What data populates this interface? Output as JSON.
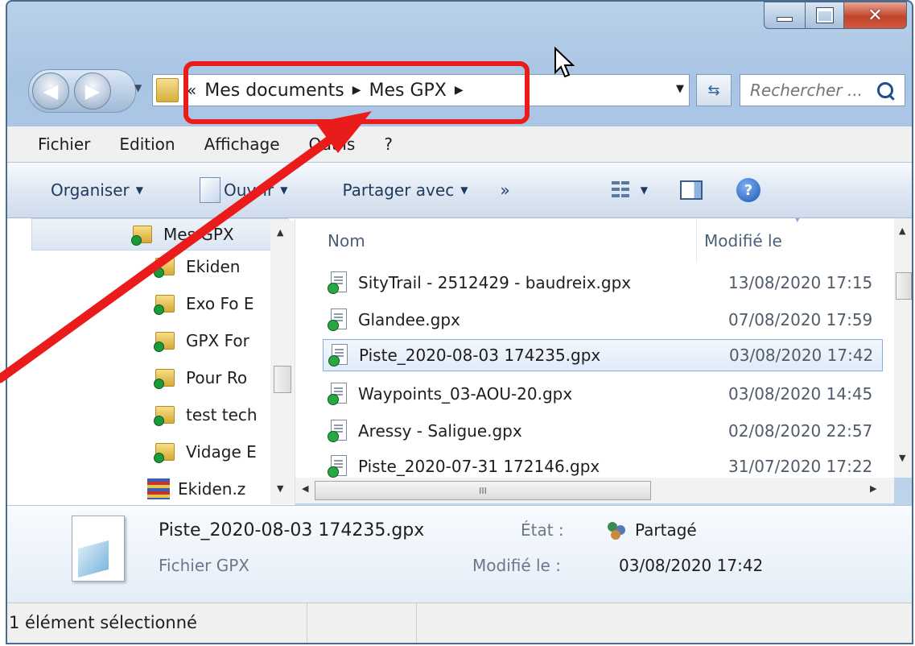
{
  "window": {
    "caption_minimize_icon": "minimize-icon",
    "caption_maximize_icon": "maximize-icon",
    "caption_close_icon": "close-icon"
  },
  "address_bar": {
    "overflow": "«",
    "breadcrumbs": [
      "Mes documents",
      "Mes GPX"
    ],
    "separator": "▶"
  },
  "search": {
    "placeholder": "Rechercher ..."
  },
  "menu": [
    "Fichier",
    "Edition",
    "Affichage",
    "Outils",
    "?"
  ],
  "toolbar": {
    "organize": "Organiser",
    "open": "Ouvrir",
    "share": "Partager avec",
    "more": "»"
  },
  "nav_tree": {
    "selected": "Mes GPX",
    "items": [
      "Ekiden",
      "Exo Fo E",
      "GPX For",
      "Pour Ro",
      "test tech",
      "Vidage E"
    ],
    "zip_item": "Ekiden.z"
  },
  "file_list": {
    "columns": [
      "Nom",
      "Modifié le"
    ],
    "rows": [
      {
        "name": "SityTrail - 2512429 - baudreix.gpx",
        "modified": "13/08/2020 17:15"
      },
      {
        "name": "Glandee.gpx",
        "modified": "07/08/2020 17:59"
      },
      {
        "name": "Piste_2020-08-03 174235.gpx",
        "modified": "03/08/2020 17:42",
        "selected": true
      },
      {
        "name": "Waypoints_03-AOU-20.gpx",
        "modified": "03/08/2020 14:45"
      },
      {
        "name": "Aressy - Saligue.gpx",
        "modified": "02/08/2020 22:57"
      },
      {
        "name": "Piste_2020-07-31 172146.gpx",
        "modified": "31/07/2020 17:22"
      }
    ],
    "hscroll_grip": "III"
  },
  "details": {
    "name": "Piste_2020-08-03 174235.gpx",
    "type": "Fichier GPX",
    "state_label": "État :",
    "state_value": "Partagé",
    "modified_label": "Modifié le :",
    "modified_value": "03/08/2020 17:42"
  },
  "status": {
    "text": "1 élément sélectionné"
  },
  "annotation": {
    "color": "#ea1b1b"
  }
}
